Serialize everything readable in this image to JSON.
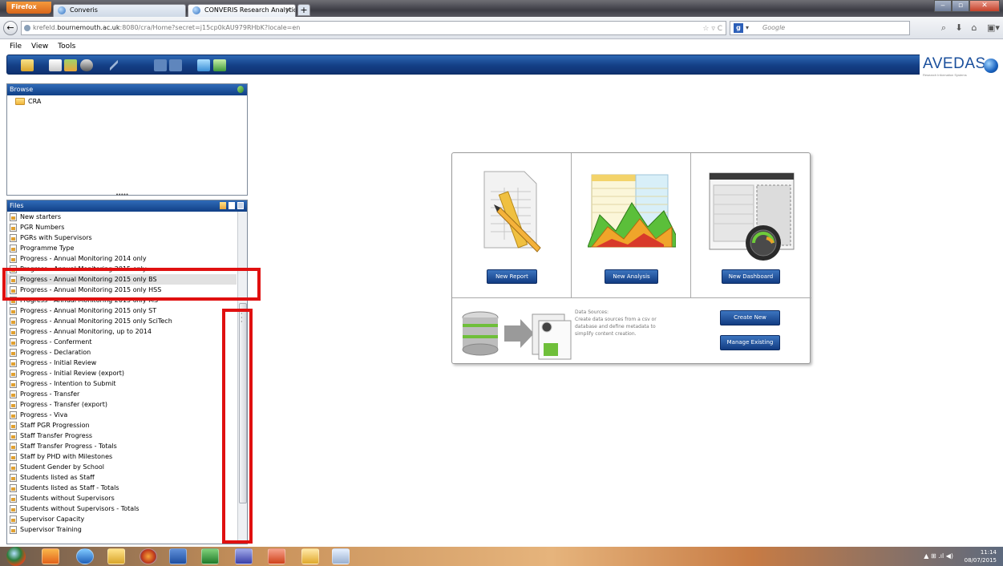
{
  "browser": {
    "firefox_button": "Firefox",
    "tabs": [
      {
        "title": "Converis"
      },
      {
        "title": "CONVERIS Research Analytics User C...",
        "close": "×"
      }
    ],
    "new_tab": "+",
    "url_host": "krefeld.",
    "url_domain": "bournemouth.ac.uk",
    "url_path": ":8080/cra/Home?secret=j15cp0kAU979RHbK?locale=en",
    "url_right": "☆ ▿ C",
    "search_placeholder": "Google"
  },
  "menu": [
    "File",
    "View",
    "Tools"
  ],
  "logo": {
    "text": "AVEDAS",
    "subtitle": "Research Information Systems"
  },
  "browse_panel": {
    "title": "Browse",
    "items": [
      {
        "label": "CRA"
      }
    ],
    "splitter": "•••••"
  },
  "files_panel": {
    "title": "Files",
    "files": [
      "New starters",
      "PGR Numbers",
      "PGRs with Supervisors",
      "Programme Type",
      "Progress - Annual Monitoring 2014 only",
      "Progress - Annual Monitoring 2015 only",
      "Progress - Annual Monitoring 2015 only BS",
      "Progress - Annual Monitoring 2015 only HSS",
      "Progress - Annual Monitoring 2015 only MS",
      "Progress - Annual Monitoring 2015 only ST",
      "Progress - Annual Monitoring 2015 only SciTech",
      "Progress - Annual Monitoring, up to 2014",
      "Progress - Conferment",
      "Progress - Declaration",
      "Progress - Initial Review",
      "Progress - Initial Review (export)",
      "Progress - Intention to Submit",
      "Progress - Transfer",
      "Progress - Transfer (export)",
      "Progress - Viva",
      "Staff PGR Progression",
      "Staff Transfer Progress",
      "Staff Transfer Progress - Totals",
      "Staff by PHD with Milestones",
      "Student Gender by School",
      "Students listed as Staff",
      "Students listed as Staff - Totals",
      "Students without Supervisors",
      "Students without Supervisors - Totals",
      "Supervisor Capacity",
      "Supervisor Training"
    ],
    "selected_index": 6
  },
  "dashboard": {
    "new_report": "New Report",
    "new_analysis": "New Analysis",
    "new_dashboard": "New Dashboard",
    "data_sources_title": "Data Sources:",
    "data_sources_text": "Create data sources from a csv or database and define metadata to simplify content creation.",
    "create_new": "Create New",
    "manage_existing": "Manage Existing"
  },
  "taskbar": {
    "time": "11:14",
    "date": "08/07/2015",
    "tray": "▲ ⊞ .ıl ◀)"
  },
  "colors": {
    "toolbar_blue": "#143f86",
    "highlight_red": "#e01010",
    "selection_gray": "#e1e1e1"
  }
}
